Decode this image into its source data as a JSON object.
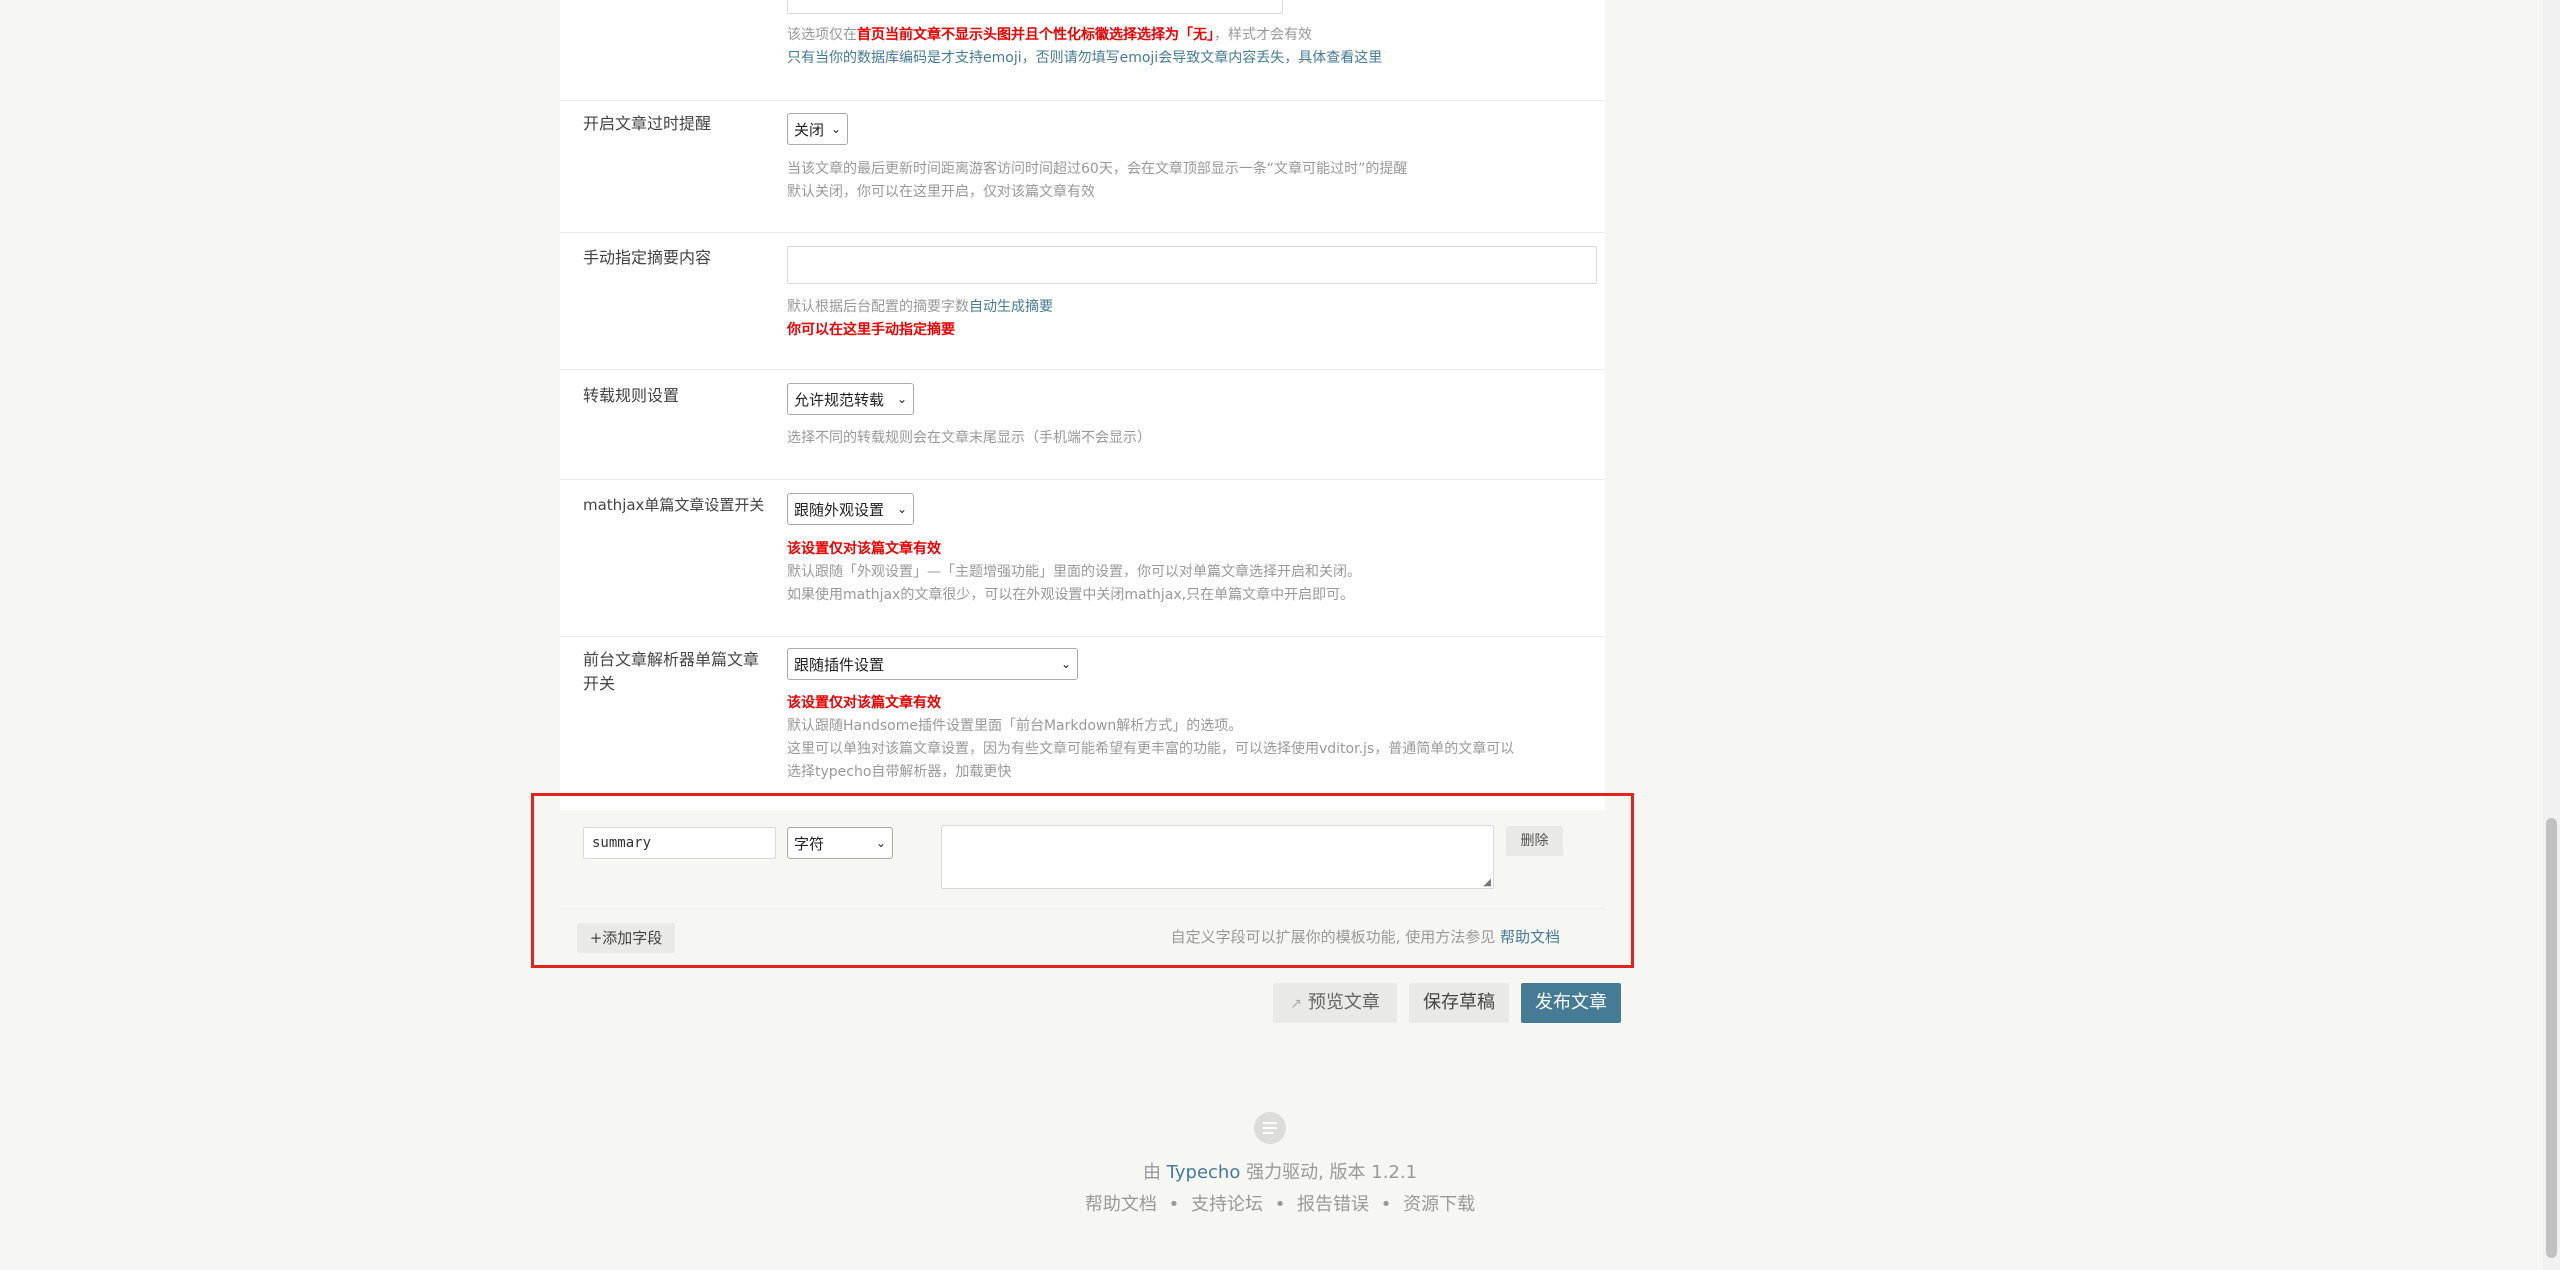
{
  "emoji_notes": {
    "line1_prefix": "该选项仅在",
    "line1_red": "首页当前文章不显示头图并且个性化标徽选择选择为「无」",
    "line1_suffix": "，样式才会有效",
    "line2_prefix": "只有当你的数据库编码是才支持emoji，否则请勿填写emoji会导致文章内容丢失，",
    "line2_link": "具体查看这里"
  },
  "outdated": {
    "label": "开启文章过时提醒",
    "value": "关闭",
    "desc1": "当该文章的最后更新时间距离游客访问时间超过60天，会在文章顶部显示一条“文章可能过时”的提醒",
    "desc2": "默认关闭，你可以在这里开启，仅对该篇文章有效"
  },
  "summary": {
    "label": "手动指定摘要内容",
    "desc1_prefix": "默认根据后台配置的摘要字数",
    "desc1_link": "自动生成摘要",
    "desc2": "你可以在这里手动指定摘要"
  },
  "reprint": {
    "label": "转载规则设置",
    "value": "允许规范转载",
    "desc": "选择不同的转载规则会在文章末尾显示（手机端不会显示）"
  },
  "mathjax": {
    "label": "mathjax单篇文章设置开关",
    "value": "跟随外观设置",
    "warn": "该设置仅对该篇文章有效",
    "desc1": "默认跟随「外观设置」—「主题增强功能」里面的设置，你可以对单篇文章选择开启和关闭。",
    "desc2": "如果使用mathjax的文章很少，可以在外观设置中关闭mathjax,只在单篇文章中开启即可。"
  },
  "parser": {
    "label": "前台文章解析器单篇文章开关",
    "value": "跟随插件设置",
    "warn": "该设置仅对该篇文章有效",
    "desc1": "默认跟随Handsome插件设置里面「前台Markdown解析方式」的选项。",
    "desc2": "这里可以单独对该篇文章设置，因为有些文章可能希望有更丰富的功能，可以选择使用vditor.js，普通简单的文章可以",
    "desc3": "选择typecho自带解析器，加载更快"
  },
  "custom_field": {
    "name_value": "summary",
    "type_value": "字符",
    "delete_label": "删除",
    "add_label": "+添加字段",
    "hint": "自定义字段可以扩展你的模板功能, 使用方法参见",
    "hint_link": "帮助文档"
  },
  "actions": {
    "preview": "预览文章",
    "save": "保存草稿",
    "publish": "发布文章"
  },
  "footer": {
    "powered_prefix": "由",
    "powered_link": "Typecho",
    "powered_suffix": "强力驱动, 版本 1.2.1",
    "links": [
      "帮助文档",
      "支持论坛",
      "报告错误",
      "资源下载"
    ],
    "sep": "•"
  }
}
